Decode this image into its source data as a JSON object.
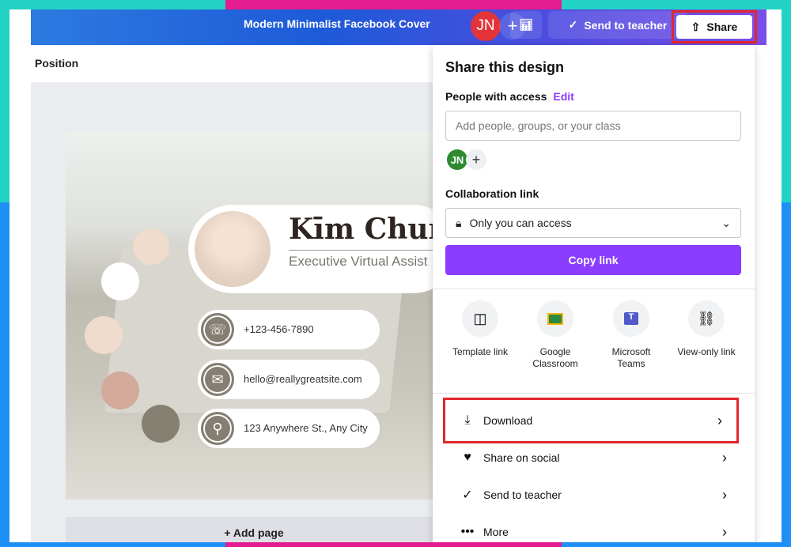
{
  "header": {
    "title": "Modern Minimalist Facebook Cover",
    "avatar_initials": "JN",
    "add_label": "+",
    "send_to_teacher": "Send to teacher",
    "share": "Share"
  },
  "sidebar": {
    "position_label": "Position"
  },
  "design": {
    "name": "Kīm Chun",
    "role": "Executive Virtual Assist",
    "phone": "+123-456-7890",
    "email": "hello@reallygreatsite.com",
    "address": "123 Anywhere St., Any City"
  },
  "canvas": {
    "add_page": "+ Add page"
  },
  "share_panel": {
    "title": "Share this design",
    "people_label": "People with access",
    "edit_label": "Edit",
    "people_placeholder": "Add people, groups, or your class",
    "member_initials": "JN",
    "collab_label": "Collaboration link",
    "access_value": "Only you can access",
    "copy_link": "Copy link",
    "options": [
      {
        "label": "Template link",
        "icon": "template-icon"
      },
      {
        "label": "Google Classroom",
        "icon": "google-classroom-icon"
      },
      {
        "label": "Microsoft Teams",
        "icon": "microsoft-teams-icon"
      },
      {
        "label": "View-only link",
        "icon": "link-icon"
      }
    ],
    "actions": [
      {
        "label": "Download",
        "icon": "download-icon"
      },
      {
        "label": "Share on social",
        "icon": "heart-icon"
      },
      {
        "label": "Send to teacher",
        "icon": "check-circle-icon"
      },
      {
        "label": "More",
        "icon": "more-icon"
      }
    ]
  },
  "colors": {
    "accent": "#8b3dff",
    "highlight": "#e3262c",
    "frame_teal": "#22d3c5",
    "frame_magenta": "#e31c8f",
    "frame_blue": "#1e90f5"
  }
}
